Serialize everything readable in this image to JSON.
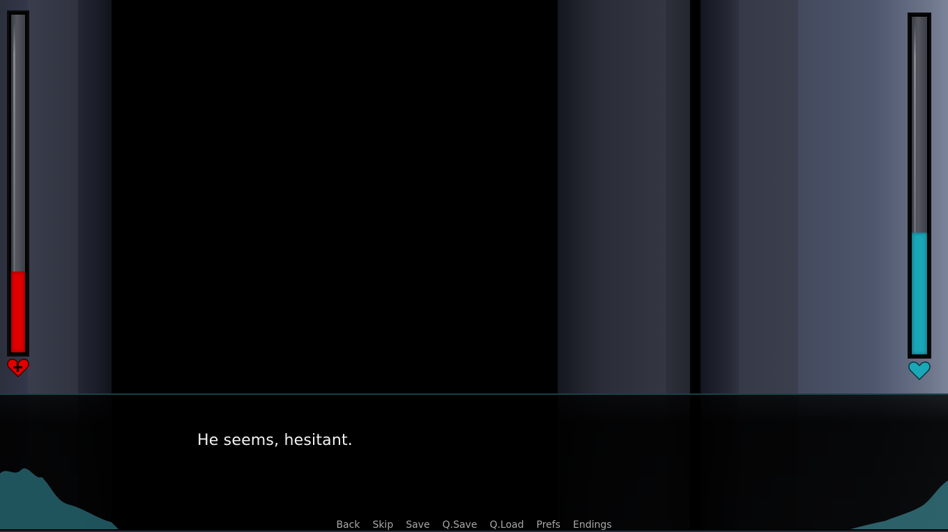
{
  "dialogue": {
    "text": "He seems, hesitant."
  },
  "stats": {
    "health": {
      "icon": "heart-plus-icon",
      "level": 0.24,
      "color": "#e00000"
    },
    "affection": {
      "icon": "heart-icon",
      "level": 0.36,
      "color": "#1aa7b8"
    }
  },
  "quick_menu": {
    "back": "Back",
    "skip": "Skip",
    "save": "Save",
    "qsave": "Q.Save",
    "qload": "Q.Load",
    "prefs": "Prefs",
    "endings": "Endings"
  },
  "colors": {
    "accent": "#1aa7b8",
    "health": "#e00000",
    "dialogue_text": "#f2f2f2",
    "menu_text": "#a9a9a9"
  }
}
